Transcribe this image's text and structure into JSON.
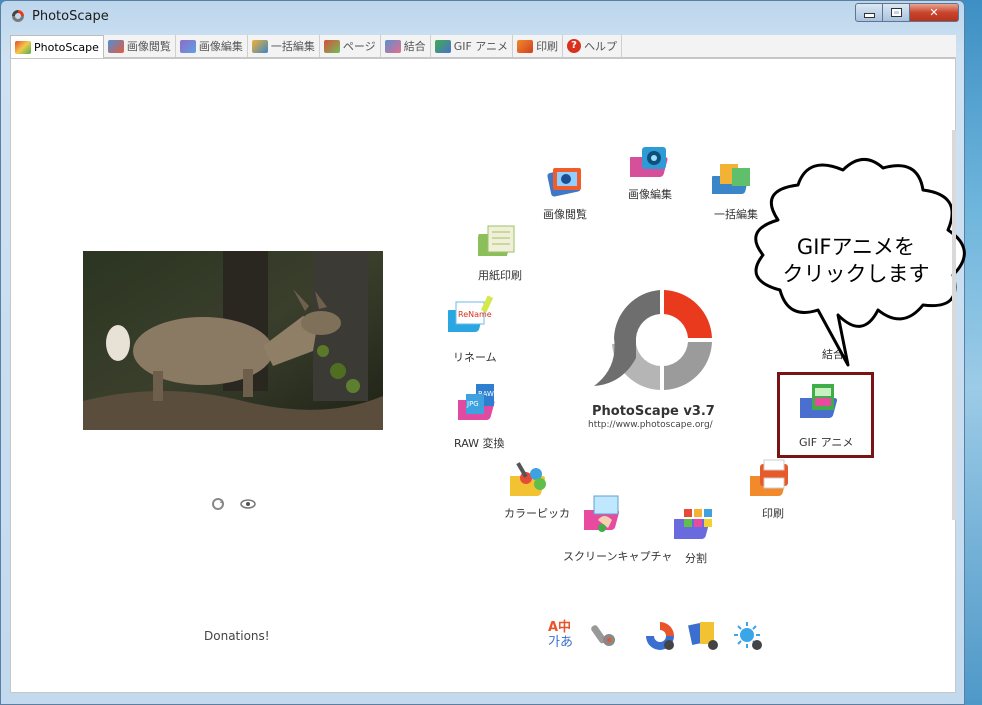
{
  "window": {
    "title": "PhotoScape"
  },
  "tabs": [
    {
      "label": "PhotoScape",
      "icon": "photoscape-tab-icon",
      "active": true
    },
    {
      "label": "画像閲覧",
      "icon": "viewer-icon"
    },
    {
      "label": "画像編集",
      "icon": "editor-icon"
    },
    {
      "label": "一括編集",
      "icon": "batch-editor-icon"
    },
    {
      "label": "ページ",
      "icon": "page-icon"
    },
    {
      "label": "結合",
      "icon": "combine-icon"
    },
    {
      "label": "GIF アニメ",
      "icon": "gif-icon"
    },
    {
      "label": "印刷",
      "icon": "print-icon"
    },
    {
      "label": "ヘルプ",
      "icon": "help-icon"
    }
  ],
  "menu": {
    "viewer": "画像閲覧",
    "editor": "画像編集",
    "batch": "一括編集",
    "combine": "結合",
    "paper_print": "用紙印刷",
    "rename": "リネーム",
    "raw": "RAW 変換",
    "color_picker": "カラーピッカ",
    "screen_capture": "スクリーンキャプチャ",
    "split": "分割",
    "print": "印刷",
    "gif": "GIF アニメ"
  },
  "logo": {
    "title": "PhotoScape v3.7",
    "url": "http://www.photoscape.org/"
  },
  "callout": {
    "line1": "GIFアニメを",
    "line2": "クリックします"
  },
  "footer": {
    "donations": "Donations!",
    "lang_icon_top": "A中",
    "lang_icon_bottom": "가あ"
  },
  "colors": {
    "highlight_border": "#7a1414",
    "logo_red": "#ea3a1e",
    "logo_gray": "#6e6e6e"
  }
}
